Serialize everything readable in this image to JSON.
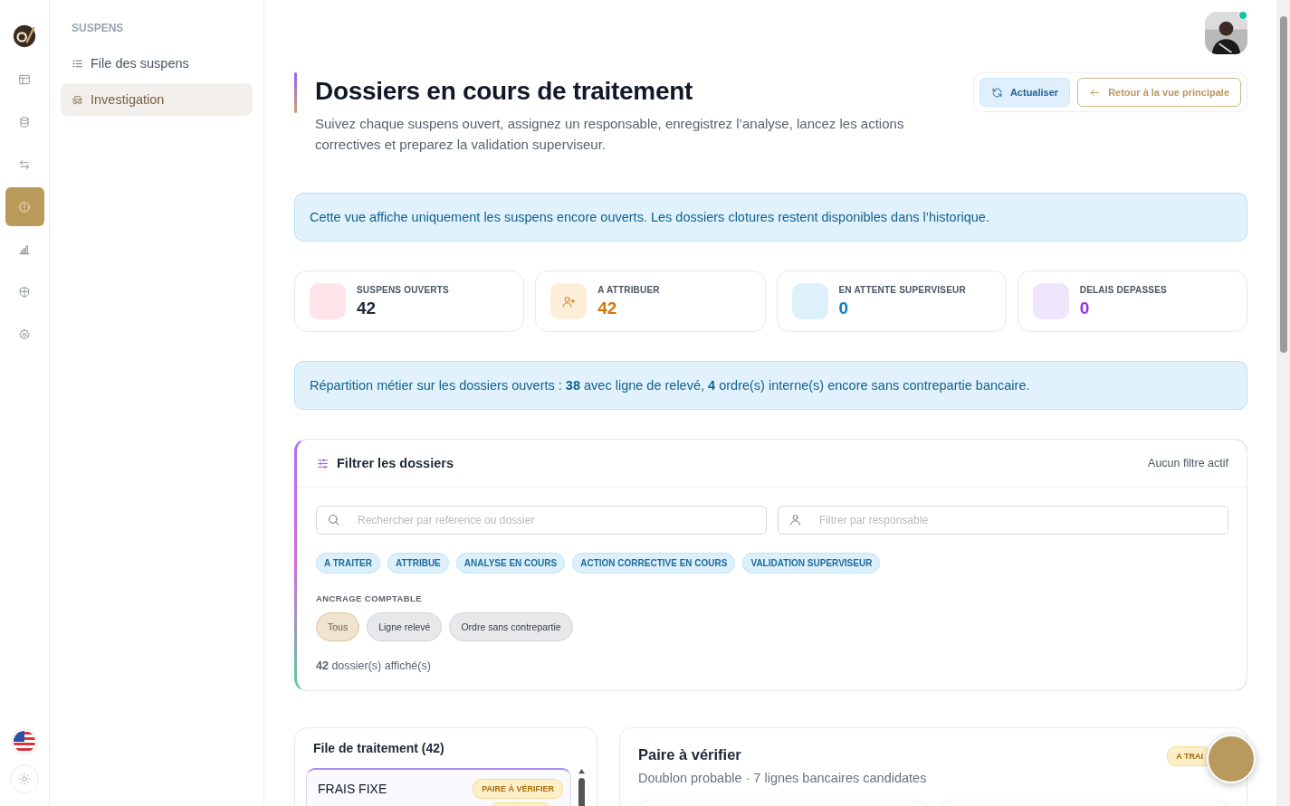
{
  "rail": {
    "items": [
      {
        "kind": "layout",
        "selected": false
      },
      {
        "kind": "database",
        "selected": false
      },
      {
        "kind": "transfer",
        "selected": false
      },
      {
        "kind": "alert",
        "selected": true
      },
      {
        "kind": "chart",
        "selected": false
      },
      {
        "kind": "shield",
        "selected": false
      },
      {
        "kind": "gear",
        "selected": false
      }
    ]
  },
  "sidebar": {
    "section": "SUSPENS",
    "items": [
      {
        "label": "File des suspens",
        "kind": "list",
        "selected": false
      },
      {
        "label": "Investigation",
        "kind": "incognito",
        "selected": true
      }
    ]
  },
  "user": {
    "online": true
  },
  "header": {
    "title": "Dossiers en cours de traitement",
    "subtitle": "Suivez chaque suspens ouvert, assignez un responsable, enregistrez l’analyse, lancez les actions correctives et preparez la validation superviseur.",
    "buttons": [
      {
        "label": "Actualiser",
        "kind": "refresh"
      },
      {
        "label": "Retour à la vue principale",
        "kind": "back"
      }
    ]
  },
  "notice": "Cette vue affiche uniquement les suspens encore ouverts. Les dossiers clotures restent disponibles dans l’historique.",
  "stats": [
    {
      "label": "SUSPENS OUVERTS",
      "kind": "blank",
      "tile": {
        "color": "#fde4e8"
      },
      "value": {
        "text": "42",
        "color": "#1f2937"
      }
    },
    {
      "label": "A ATTRIBUER",
      "kind": "assign",
      "tile": {
        "color": "#fdeeda"
      },
      "value": {
        "text": "42",
        "color": "#d9750a"
      }
    },
    {
      "label": "EN ATTENTE SUPERVISEUR",
      "kind": "blank",
      "tile": {
        "color": "#ddf1fb"
      },
      "value": {
        "text": "0",
        "color": "#0a7fc0"
      }
    },
    {
      "label": "DELAIS DEPASSES",
      "kind": "blank",
      "tile": {
        "color": "#efe5fd"
      },
      "value": {
        "text": "0",
        "color": "#9333ea"
      }
    }
  ],
  "breakdown": "Répartition métier sur les dossiers ouverts : **38** avec ligne de relevé, **4** ordre(s) interne(s) encore sans contrepartie bancaire.",
  "filters": {
    "title": "Filtrer les dossiers",
    "status": "Aucun filtre actif",
    "search": {
      "placeholder": "Rechercher par reference ou dossier"
    },
    "owner": {
      "placeholder": "Filtrer par responsable"
    },
    "statuses": [
      "A TRAITER",
      "ATTRIBUE",
      "ANALYSE EN COURS",
      "ACTION CORRECTIVE EN COURS",
      "VALIDATION SUPERVISEUR"
    ],
    "anchor_label": "ANCRAGE COMPTABLE",
    "anchors": [
      {
        "label": "Tous",
        "selected": true
      },
      {
        "label": "Ligne relevé",
        "selected": false
      },
      {
        "label": "Ordre sans contrepartie",
        "selected": false
      }
    ],
    "count": "**42** dossier(s) affiché(s)"
  },
  "queue": {
    "title": "File de traitement (42)",
    "items": [
      {
        "title": "FRAIS FIXE",
        "badge": "PAIRE À VÉRIFIER"
      }
    ]
  },
  "detail": {
    "title": "Paire à vérifier",
    "subtitle": "Doublon probable · 7 lignes bancaires candidates",
    "badge": "A TRAI"
  }
}
